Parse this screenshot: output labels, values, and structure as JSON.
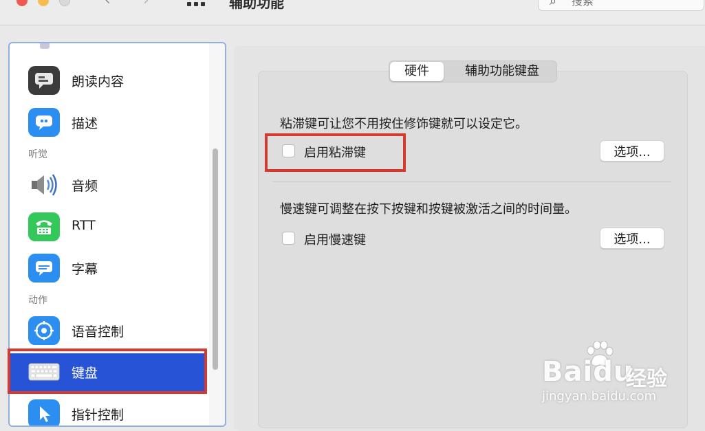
{
  "window": {
    "title": "辅助功能",
    "search_placeholder": "搜索"
  },
  "sidebar": {
    "items": [
      {
        "label": "朗读内容",
        "icon": "speech-bubble-icon",
        "color": "#3a3a3a"
      },
      {
        "label": "描述",
        "icon": "description-bubble-icon",
        "color": "#2b8ef0"
      },
      {
        "section": "听觉"
      },
      {
        "label": "音频",
        "icon": "speaker-icon",
        "color": "#8a8a8a"
      },
      {
        "label": "RTT",
        "icon": "tty-phone-icon",
        "color": "#34c759"
      },
      {
        "label": "字幕",
        "icon": "captions-icon",
        "color": "#2b8ef0"
      },
      {
        "section": "动作"
      },
      {
        "label": "语音控制",
        "icon": "voice-control-icon",
        "color": "#2b8ef0"
      },
      {
        "label": "键盘",
        "icon": "keyboard-icon",
        "color": "#e6e6e6",
        "selected": true
      },
      {
        "label": "指针控制",
        "icon": "pointer-icon",
        "color": "#2b8ef0"
      }
    ],
    "section_hearing": "听觉",
    "section_motor": "动作"
  },
  "tabs": {
    "hardware": "硬件",
    "accessibility_keyboard": "辅助功能键盘"
  },
  "sticky_keys": {
    "description": "粘滞键可让您不用按住修饰键就可以设定它。",
    "checkbox_label": "启用粘滞键",
    "checked": false,
    "options_button": "选项..."
  },
  "slow_keys": {
    "description": "慢速键可调整在按下按键和按键被激活之间的时间量。",
    "checkbox_label": "启用慢速键",
    "checked": false,
    "options_button": "选项..."
  },
  "watermark": {
    "brand": "Baidu",
    "brand_suffix": "经验",
    "url": "jingyan.baidu.com"
  },
  "colors": {
    "selection": "#2754d6",
    "annotation": "#d63a2e",
    "sidebar_focus": "#8fb0e3"
  }
}
